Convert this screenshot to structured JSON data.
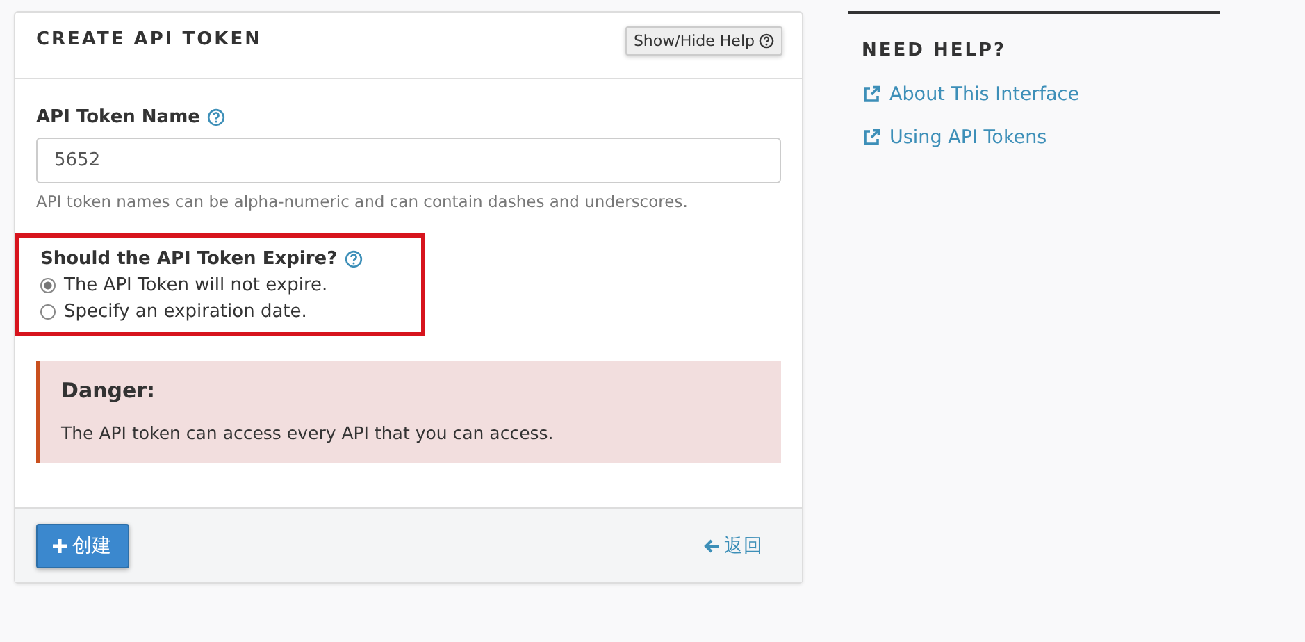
{
  "panel": {
    "title": "CREATE API TOKEN",
    "help_button": "Show/Hide Help"
  },
  "token_name": {
    "label": "API Token Name",
    "value": "5652",
    "hint": "API token names can be alpha-numeric and can contain dashes and underscores."
  },
  "expire": {
    "label": "Should the API Token Expire?",
    "highlighted": true,
    "options": [
      {
        "label": "The API Token will not expire.",
        "selected": true
      },
      {
        "label": "Specify an expiration date.",
        "selected": false
      }
    ]
  },
  "alert": {
    "title": "Danger:",
    "text": "The API token can access every API that you can access."
  },
  "footer": {
    "create_button": "创建",
    "back_link": "返回"
  },
  "help": {
    "title": "NEED HELP?",
    "links": [
      "About This Interface",
      "Using API Tokens"
    ]
  }
}
